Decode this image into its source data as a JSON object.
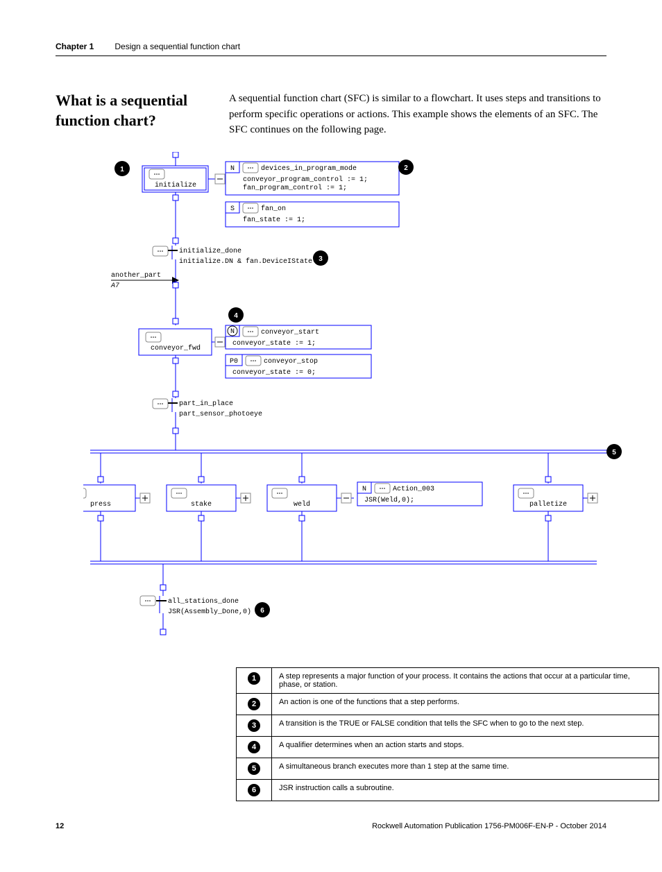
{
  "header": {
    "chapter_label": "Chapter 1",
    "chapter_title": "Design a sequential function chart"
  },
  "section": {
    "heading": "What is a sequential function chart?",
    "body": "A sequential function chart (SFC) is similar to a flowchart. It uses steps and transitions to perform specific operations or actions. This example shows the elements of an SFC. The SFC continues on the following page."
  },
  "diagram": {
    "step_initialize": "initialize",
    "action_devices": "devices_in_program_mode",
    "action_devices_code1": "conveyor_program_control := 1;",
    "action_devices_code2": "fan_program_control := 1;",
    "action_fan_on": "fan_on",
    "action_fan_on_code": "fan_state := 1;",
    "qualifier_N": "N",
    "qualifier_S": "S",
    "qualifier_P0": "P0",
    "trans_initialize_done": "initialize_done",
    "trans_initialize_code": "initialize.DN & fan.DeviceIState",
    "label_another_part": "another_part",
    "label_A7": "A7",
    "step_conveyor_fwd": "conveyor_fwd",
    "action_conveyor_start": "conveyor_start",
    "action_conveyor_start_code": "conveyor_state := 1;",
    "action_conveyor_stop": "conveyor_stop",
    "action_conveyor_stop_code": "conveyor_state := 0;",
    "trans_part_in_place": "part_in_place",
    "trans_part_code": "part_sensor_photoeye",
    "step_press": "press",
    "step_stake": "stake",
    "step_weld": "weld",
    "step_palletize": "palletize",
    "action_003": "Action_003",
    "action_003_code": "JSR(Weld,0);",
    "trans_all_stations": "all_stations_done",
    "trans_all_stations_code": "JSR(Assembly_Done,0)"
  },
  "legend": [
    {
      "num": "1",
      "text": "A step represents a major function of your process. It contains the actions that occur at a particular time, phase, or station."
    },
    {
      "num": "2",
      "text": "An action is one of the functions that a step performs."
    },
    {
      "num": "3",
      "text": "A transition is the TRUE or FALSE condition that tells the SFC when to go to the next step."
    },
    {
      "num": "4",
      "text": "A qualifier determines when an action starts and stops."
    },
    {
      "num": "5",
      "text": "A simultaneous branch executes more than 1 step at the same time."
    },
    {
      "num": "6",
      "text": "JSR instruction calls a subroutine."
    }
  ],
  "footer": {
    "page": "12",
    "pub": "Rockwell Automation Publication 1756-PM006F-EN-P - October 2014"
  }
}
